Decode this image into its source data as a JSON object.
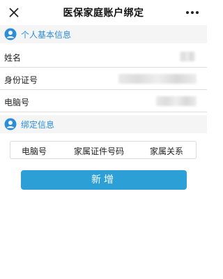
{
  "nav": {
    "title": "医保家庭账户绑定"
  },
  "personal_section": {
    "title": "个人基本信息",
    "icon": "user-icon",
    "fields": [
      {
        "label": "姓名",
        "value": ""
      },
      {
        "label": "身份证号",
        "value": ""
      },
      {
        "label": "电脑号",
        "value": ""
      }
    ]
  },
  "binding_section": {
    "title": "绑定信息",
    "icon": "user-icon",
    "table_headers": [
      "电脑号",
      "家属证件号码",
      "家属关系"
    ]
  },
  "add_button": {
    "label": "新增"
  },
  "colors": {
    "accent": "#2b8ed6",
    "button": "#2b9fd6",
    "section_bg": "#f5f5f5"
  }
}
